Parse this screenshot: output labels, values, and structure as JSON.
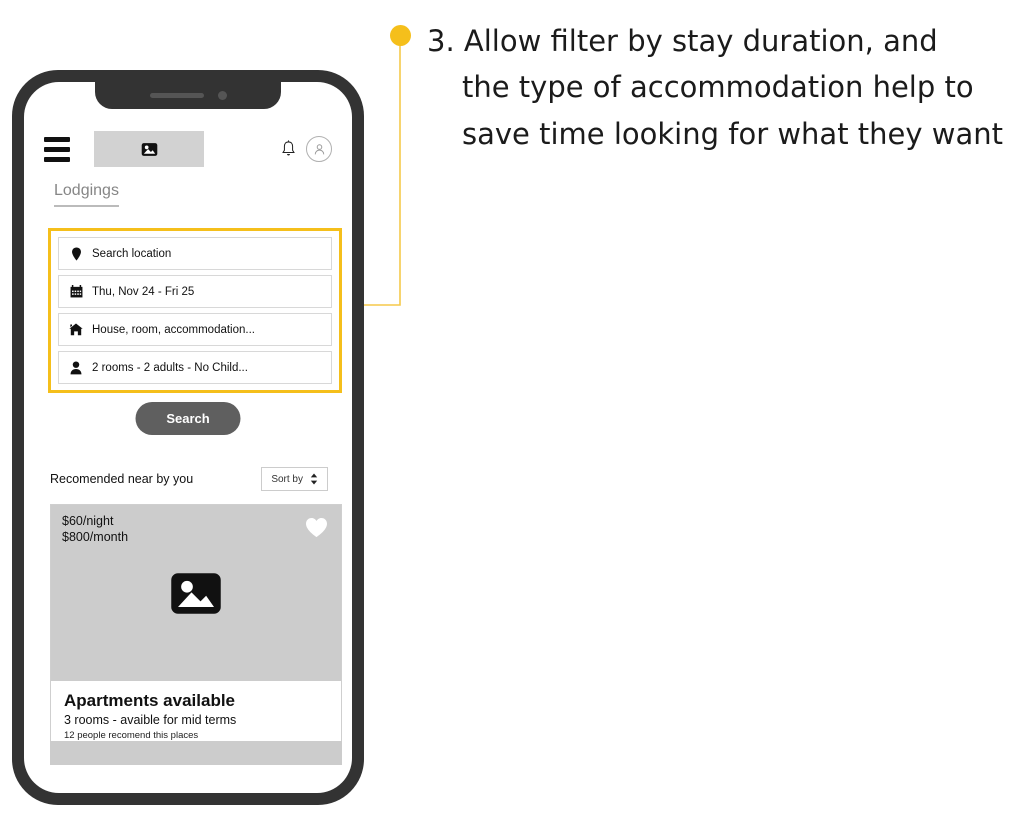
{
  "annotation": {
    "number": "3.",
    "lines": [
      "3. Allow filter by stay duration, and",
      "the type of accommodation help to",
      "save time looking for what they want"
    ],
    "dot_color": "#f5bf1b",
    "connector_color": "#f5c94a"
  },
  "phone": {
    "frame_color": "#333333",
    "screen_color": "#ffffff"
  },
  "header": {
    "menu_icon": "hamburger-menu-icon",
    "logo_placeholder": "image-placeholder-icon",
    "notification_icon": "bell-icon",
    "avatar_icon": "user-avatar-icon"
  },
  "tabs": [
    {
      "label": "Lodgings",
      "active": true
    }
  ],
  "search_panel": {
    "highlight_color": "#f5bf1b",
    "fields": [
      {
        "icon": "map-pin-icon",
        "value": "Search location"
      },
      {
        "icon": "calendar-icon",
        "value": "Thu, Nov 24 - Fri 25"
      },
      {
        "icon": "house-icon",
        "value": "House, room, accommodation..."
      },
      {
        "icon": "person-icon",
        "value": "2 rooms - 2 adults - No Child..."
      }
    ],
    "search_button_label": "Search",
    "search_button_color": "#5f5f5f"
  },
  "recommendations": {
    "section_label": "Recomended near by you",
    "sort_label": "Sort by",
    "sort_icon": "sort-updown-icon",
    "card": {
      "price_night": "$60/night",
      "price_month": "$800/month",
      "favorite_icon": "heart-icon",
      "image_placeholder": "image-placeholder-icon",
      "title": "Apartments available",
      "subtitle": "3 rooms - avaible for mid terms",
      "meta": "12 people recomend this places"
    }
  }
}
